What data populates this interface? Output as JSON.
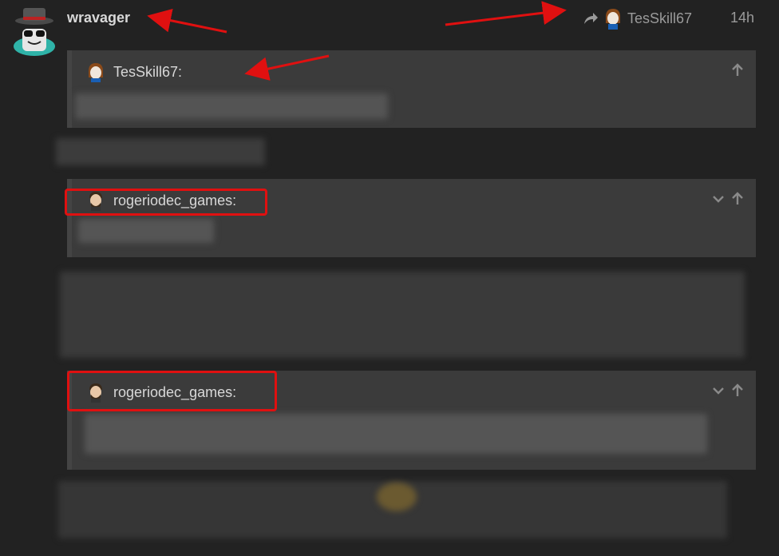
{
  "post": {
    "author": "wravager",
    "reply_to_user": "TesSkill67",
    "time": "14h"
  },
  "quotes": [
    {
      "user": "TesSkill67:"
    },
    {
      "user": "rogeriodec_games:"
    },
    {
      "user": "rogeriodec_games:"
    }
  ],
  "colors": {
    "background": "#222222",
    "quote_bg": "#3b3b3b",
    "highlight": "#e01010",
    "muted_text": "#9a9a9a"
  },
  "icons": {
    "reply": "share-arrow-icon",
    "expand": "chevron-down-icon",
    "jump": "arrow-up-icon"
  }
}
